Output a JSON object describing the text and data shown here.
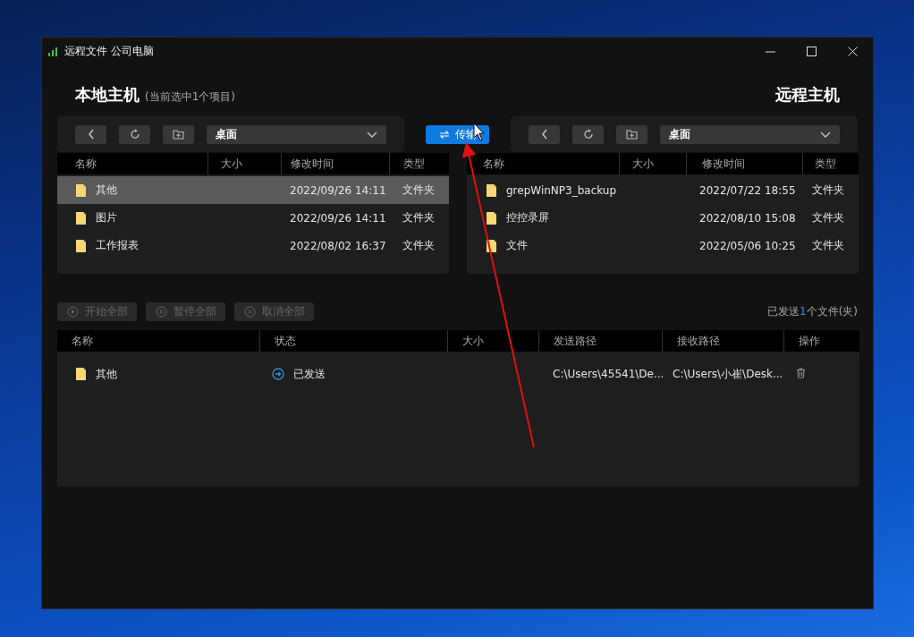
{
  "window": {
    "title": "远程文件 公司电脑"
  },
  "local": {
    "heading": "本地主机",
    "selection_note": "(当前选中1个项目)",
    "path": "桌面",
    "columns": [
      "名称",
      "大小",
      "修改时间",
      "类型"
    ],
    "rows": [
      {
        "name": "其他",
        "modified": "2022/09/26 14:11",
        "type": "文件夹",
        "selected": true
      },
      {
        "name": "图片",
        "modified": "2022/09/26 14:11",
        "type": "文件夹",
        "selected": false
      },
      {
        "name": "工作报表",
        "modified": "2022/08/02 16:37",
        "type": "文件夹",
        "selected": false
      }
    ]
  },
  "transfer_button": {
    "label": "传输"
  },
  "remote": {
    "heading": "远程主机",
    "path": "桌面",
    "columns": [
      "名称",
      "大小",
      "修改时间",
      "类型"
    ],
    "rows": [
      {
        "name": "grepWinNP3_backup",
        "modified": "2022/07/22 18:55",
        "type": "文件夹",
        "selected": false
      },
      {
        "name": "控控录屏",
        "modified": "2022/08/10 15:08",
        "type": "文件夹",
        "selected": false
      },
      {
        "name": "文件",
        "modified": "2022/05/06 10:25",
        "type": "文件夹",
        "selected": false
      }
    ]
  },
  "transfer_actions": [
    {
      "kind": "start",
      "label": "开始全部",
      "disabled": true
    },
    {
      "kind": "pause",
      "label": "暂停全部",
      "disabled": true
    },
    {
      "kind": "cancel",
      "label": "取消全部",
      "disabled": true
    }
  ],
  "sent_summary": {
    "prefix": "已发送",
    "count": "1",
    "suffix": "个文件(夹)"
  },
  "transfers": {
    "columns": [
      "名称",
      "状态",
      "大小",
      "发送路径",
      "接收路径",
      "操作"
    ],
    "rows": [
      {
        "name": "其他",
        "status": "已发送",
        "source": "C:\\Users\\45541\\De...",
        "destination": "C:\\Users\\小崔\\Desk..."
      }
    ]
  }
}
